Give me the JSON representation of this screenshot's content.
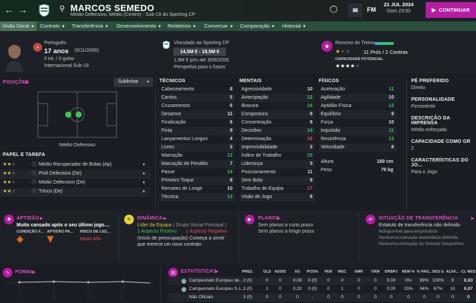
{
  "header": {
    "player_name": "MARCOS SEMEDO",
    "subtitle": "Médio Defensivo, Médio (Centro) - Sub-19 do Sporting CP",
    "fm_label": "FM",
    "date": "21 JUL 2024",
    "time": "Dom 23:00",
    "continue_label": "CONTINUAR"
  },
  "tabs": [
    {
      "label": "Visão Geral"
    },
    {
      "label": "Contrato"
    },
    {
      "label": "Transferência"
    },
    {
      "label": "Desenvolvimento"
    },
    {
      "label": "Relatórios"
    },
    {
      "label": "Conversar"
    },
    {
      "label": "Comparação"
    },
    {
      "label": "Historial"
    }
  ],
  "profile": {
    "nationality": "Português",
    "age": "17 anos",
    "birth": "(5/11/2006)",
    "caps": "0 int. / 0 golos",
    "intl": "Internacional Sub-19",
    "club_link": "Vinculado ao Sporting CP",
    "value": "14,5M € - 18,5M €",
    "wage": "1,9M € p/m até 30/6/2026",
    "prospect": "Perspetiva para o futuro",
    "training_label": "Resumo do Treino",
    "pros_cons": "11 Prós / 2 Contras",
    "potential_label": "CAPACIDADE POTENCIAL",
    "potential_stars": 4
  },
  "positions": {
    "header": "POSIÇÕES",
    "dropdown": "Sublinhar",
    "position_label": "Médio Defensivo",
    "role_header": "PAPEL E TAREFA",
    "roles": [
      {
        "label": "Médio Recuperador de Bolas (Ap)"
      },
      {
        "label": "Pivô Defensivo (De)"
      },
      {
        "label": "Médio Defensivo (De)"
      },
      {
        "label": "Trinco (De)"
      }
    ]
  },
  "technical": {
    "header": "TÉCNICOS",
    "attrs": [
      {
        "name": "Cabeceamento",
        "value": "8",
        "cls": ""
      },
      {
        "name": "Cantos",
        "value": "5",
        "cls": ""
      },
      {
        "name": "Cruzamentos",
        "value": "6",
        "cls": ""
      },
      {
        "name": "Desarme",
        "value": "11",
        "cls": ""
      },
      {
        "name": "Finalização",
        "value": "6",
        "cls": ""
      },
      {
        "name": "Finta",
        "value": "9",
        "cls": ""
      },
      {
        "name": "Lançamentos Longos",
        "value": "4",
        "cls": ""
      },
      {
        "name": "Livres",
        "value": "3",
        "cls": ""
      },
      {
        "name": "Marcação",
        "value": "13",
        "cls": "grn"
      },
      {
        "name": "Marcação de Penáltis",
        "value": "7",
        "cls": ""
      },
      {
        "name": "Passe",
        "value": "14",
        "cls": "grn"
      },
      {
        "name": "Primeiro Toque",
        "value": "8",
        "cls": ""
      },
      {
        "name": "Remates de Longe",
        "value": "10",
        "cls": ""
      },
      {
        "name": "Técnica",
        "value": "13",
        "cls": "grn"
      }
    ]
  },
  "mental": {
    "header": "MENTAIS",
    "attrs": [
      {
        "name": "Agressividade",
        "value": "10",
        "cls": ""
      },
      {
        "name": "Antecipação",
        "value": "12",
        "cls": "grn"
      },
      {
        "name": "Bravura",
        "value": "14",
        "cls": "grn"
      },
      {
        "name": "Compostura",
        "value": "8",
        "cls": ""
      },
      {
        "name": "Concentração",
        "value": "8",
        "cls": ""
      },
      {
        "name": "Decisões",
        "value": "14",
        "cls": "grn"
      },
      {
        "name": "Determinação",
        "value": "16",
        "cls": "red"
      },
      {
        "name": "Imprevisibilidade",
        "value": "3",
        "cls": ""
      },
      {
        "name": "Índice de Trabalho",
        "value": "15",
        "cls": "grn"
      },
      {
        "name": "Liderança",
        "value": "5",
        "cls": ""
      },
      {
        "name": "Posicionamento",
        "value": "11",
        "cls": ""
      },
      {
        "name": "Sem Bola",
        "value": "9",
        "cls": ""
      },
      {
        "name": "Trabalho de Equipa",
        "value": "17",
        "cls": "red"
      },
      {
        "name": "Visão de Jogo",
        "value": "8",
        "cls": ""
      }
    ]
  },
  "physical": {
    "header": "FÍSICOS",
    "attrs": [
      {
        "name": "Aceleração",
        "value": "11",
        "cls": "grn"
      },
      {
        "name": "Agilidade",
        "value": "10",
        "cls": ""
      },
      {
        "name": "Aptidão Física",
        "value": "12",
        "cls": "grn"
      },
      {
        "name": "Equilíbrio",
        "value": "9",
        "cls": ""
      },
      {
        "name": "Força",
        "value": "10",
        "cls": ""
      },
      {
        "name": "Impulsão",
        "value": "11",
        "cls": "grn"
      },
      {
        "name": "Resistência",
        "value": "13",
        "cls": "grn"
      },
      {
        "name": "Velocidade",
        "value": "8",
        "cls": ""
      }
    ],
    "height_label": "Altura",
    "height": "189 cm",
    "weight_label": "Peso",
    "weight": "79 kg"
  },
  "info": {
    "pref_foot_h": "PÉ PREFERIDO",
    "pref_foot": "Direito",
    "personality_h": "PERSONALIDADE",
    "personality": "Persistente",
    "press_h": "DESCRIÇÃO DA IMPRENSA",
    "press": "Médio esforçado",
    "gr_h": "CAPACIDADE COMO GR",
    "gr": "2",
    "chars_h": "CARACTERÍSTICAS DO JO...",
    "chars": "Para o Jogo"
  },
  "panels": {
    "aptidao_h": "APTIDÃO",
    "aptidao_text": "Muito cansado após o seu último jogo....",
    "cond_label": "CONDIÇÃO F...",
    "apt_label": "APTIDÃO PA...",
    "risk_label": "RISCO DE LES...",
    "risk_value": "Muito Alto",
    "dinamica_h": "DINÂMICA",
    "din_line1a": "Líder da Equipa",
    "din_line1b": " ( Grupo Social Principal )",
    "din_pos": "1 Aspecto Positivo",
    "din_neg": "1 Aspecto Negativo",
    "din_text": "(Início de preocupação) Começa a sentir que merece um novo contrato",
    "planos_h": "PLANOS",
    "planos_1": "Sem planos a curto prazo",
    "planos_2": "Sem planos a longo prazo",
    "transf_h": "SITUAÇÃO DE TRANSFERÊNCIA",
    "transf_1": "Estatuto de transferência não definido",
    "transf_2": "Indisponível para empréstimo",
    "transf_3": "Nenhuma instrução automática definida",
    "transf_4": "Nenhuma instrução do Director Desportivo"
  },
  "forma_h": "FORMA",
  "stats": {
    "header": "ESTATÍSTICAS",
    "columns": [
      "PRES.",
      "GLS",
      "ASSIS",
      "XG",
      "POS%",
      "PEN",
      "MEC",
      "AMR",
      "VRM",
      "DRBPJ",
      "REM %",
      "% PAS...",
      "DES G",
      "ALÍVI...",
      "CL MED"
    ],
    "rows": [
      {
        "comp": "Campeonato Europeu de...",
        "cells": [
          "3 (0)",
          "0",
          "0",
          "0,08",
          "0 (0)",
          "0",
          "0",
          "0",
          "0",
          "0,00",
          "0%",
          "89%",
          "100%",
          "8",
          "6,83"
        ]
      },
      {
        "comp": "Campeonato Europeu S-1...",
        "cells": [
          "3 (0)",
          "1",
          "0",
          "0,32",
          "0 (0)",
          "0",
          "1",
          "0",
          "0",
          "0,00",
          "33%",
          "94%",
          "67%",
          "10",
          "6,87"
        ]
      },
      {
        "comp": "Não Oficiais",
        "cells": [
          "3 (0)",
          "0",
          "0",
          "0",
          "-",
          "0",
          "0",
          "0",
          "0",
          "0",
          "0",
          "0",
          "0",
          "0",
          "0"
        ]
      }
    ]
  },
  "colors": {
    "accent": "#b51ca3",
    "green": "#3ec74e",
    "red": "#e25050",
    "header_green": "#2b4f3d"
  }
}
